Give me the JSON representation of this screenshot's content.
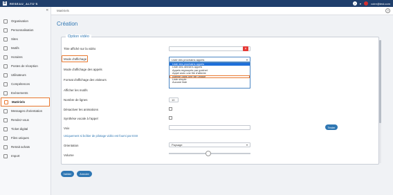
{
  "topbar": {
    "logo_letter": "R",
    "brand": "RESEAU_ALTO'S",
    "user_email": "votre@test.com",
    "user_caret": "▾",
    "help_glyph": "?"
  },
  "sidebar": {
    "items": [
      {
        "label": "Organisation",
        "icon": "building-icon"
      },
      {
        "label": "Personnalisation",
        "icon": "palette-icon"
      },
      {
        "label": "Sites",
        "icon": "pin-icon"
      },
      {
        "label": "Motifs",
        "icon": "list-icon"
      },
      {
        "label": "Horaires",
        "icon": "clock-icon"
      },
      {
        "label": "Postes de réception",
        "icon": "desk-icon"
      },
      {
        "label": "Utilisateurs",
        "icon": "users-icon"
      },
      {
        "label": "Compétences",
        "icon": "badge-icon"
      },
      {
        "label": "Evénements",
        "icon": "calendar-icon"
      },
      {
        "label": "Matériels",
        "icon": "device-icon",
        "active": true
      },
      {
        "label": "Messages d'orientation",
        "icon": "message-icon"
      },
      {
        "label": "Rendez-vous",
        "icon": "calendar-check-icon"
      },
      {
        "label": "Ticket digital",
        "icon": "ticket-icon"
      },
      {
        "label": "Files uniques",
        "icon": "queue-icon"
      },
      {
        "label": "Retrait achats",
        "icon": "bag-icon"
      },
      {
        "label": "Import",
        "icon": "upload-icon"
      }
    ]
  },
  "breadcrumb": "Matériels",
  "page_title": "Création",
  "section_legend": "Option vidéo",
  "fields": {
    "titre_label": "Titre affiché sur la vidéo",
    "mode_affichage_label": "Mode d'affichage",
    "mode_appels_label": "Mode d'affichage des appels",
    "format_label": "Format d'affichage des visiteurs",
    "afficher_motifs_label": "Afficher les motifs",
    "nombre_lignes_label": "Nombre de lignes",
    "nombre_lignes_value": "10",
    "desactiver_animations_label": "Désactiver les animations",
    "synthese_label": "Synthèse vocale à l'appel",
    "voix_label": "Voix",
    "tester_button": "Tester",
    "note": "Uniquement si boîtier de pilotage vidéo est fourni par ESII",
    "orientation_label": "Orientation",
    "orientation_value": "Paysage",
    "volume_label": "Volume"
  },
  "mode_select": {
    "selected": "Liste des prochains appels",
    "options": [
      "Liste des prochains appels",
      "Liste des derniers appels",
      "Appels regroupés par guichet",
      "Appel avec une file d'attente",
      "Attente dans une file unique",
      "Liste simple",
      "Aucune liste"
    ],
    "highlighted_index": 0,
    "outlined_index": 4
  },
  "volume": {
    "level": 0.48
  },
  "buttons": {
    "valider": "Valider",
    "annuler": "Annuler"
  },
  "colors": {
    "primary": "#2f77b3",
    "highlight": "#e8762c",
    "topbar": "#1f3e6b",
    "danger": "#e53935"
  }
}
